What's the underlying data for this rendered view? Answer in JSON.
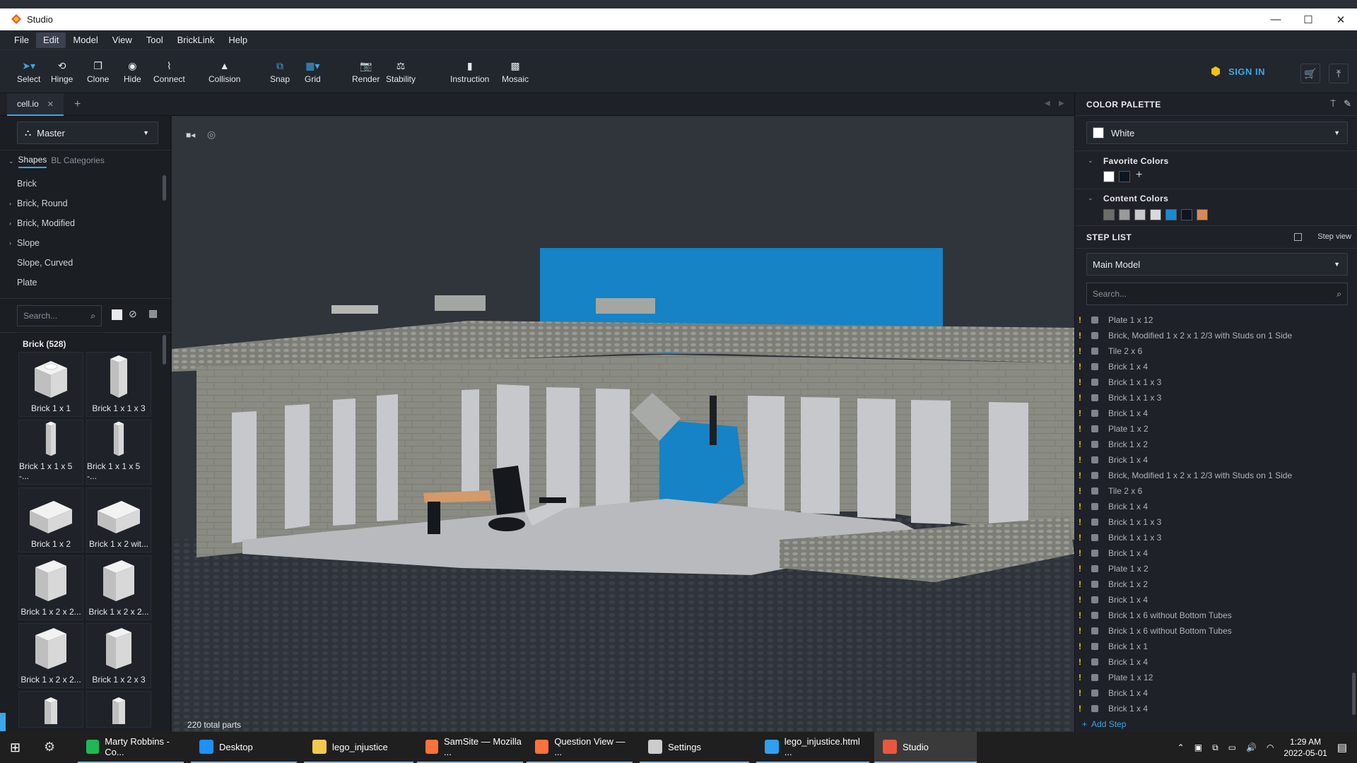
{
  "window": {
    "title": "Studio",
    "controls": [
      "—",
      "☐",
      "✕"
    ]
  },
  "menu": [
    "File",
    "Edit",
    "Model",
    "View",
    "Tool",
    "BrickLink",
    "Help"
  ],
  "toolbar": {
    "tools": [
      {
        "label": "Select",
        "icon": "cursor-icon"
      },
      {
        "label": "Hinge",
        "icon": "hinge-icon"
      },
      {
        "label": "Clone",
        "icon": "clone-icon"
      },
      {
        "label": "Hide",
        "icon": "hide-icon"
      },
      {
        "label": "Connect",
        "icon": "connect-icon"
      },
      {
        "label": "Collision",
        "icon": "collision-icon"
      },
      {
        "label": "Snap",
        "icon": "snap-icon"
      },
      {
        "label": "Grid",
        "icon": "grid-icon"
      },
      {
        "label": "Render",
        "icon": "camera-icon"
      },
      {
        "label": "Stability",
        "icon": "stability-icon"
      },
      {
        "label": "Instruction",
        "icon": "instruction-icon"
      },
      {
        "label": "Mosaic",
        "icon": "mosaic-icon"
      }
    ],
    "sign_in": "SIGN IN"
  },
  "tabs": {
    "active": "cell.io",
    "close": "✕",
    "add": "+"
  },
  "left": {
    "model_select": "Master",
    "shapes_tab": "Shapes",
    "bl_tab": "BL Categories",
    "categories": [
      {
        "label": "Brick",
        "expand": ""
      },
      {
        "label": "Brick, Round",
        "expand": "›"
      },
      {
        "label": "Brick, Modified",
        "expand": "›"
      },
      {
        "label": "Slope",
        "expand": "›"
      },
      {
        "label": "Slope, Curved",
        "expand": ""
      },
      {
        "label": "Plate",
        "expand": ""
      }
    ],
    "search_placeholder": "Search...",
    "group_title": "Brick (528)",
    "parts": [
      "Brick 1 x 1",
      "Brick 1 x 1 x 3",
      "Brick 1 x 1 x 5 -...",
      "Brick 1 x 1 x 5 -...",
      "Brick 1 x 2",
      "Brick 1 x 2 wit...",
      "Brick 1 x 2 x 2...",
      "Brick 1 x 2 x 2...",
      "Brick 1 x 2 x 2...",
      "Brick 1 x 2 x 3"
    ]
  },
  "viewport": {
    "parts_count": "220 total parts",
    "brick_color": "#8a8b82",
    "blue": "#1484c4"
  },
  "right": {
    "palette_title": "COLOR PALETTE",
    "color_select": "White",
    "favorite_title": "Favorite Colors",
    "favorite_colors": [
      "#ffffff",
      "#0b1620"
    ],
    "content_title": "Content Colors",
    "content_colors": [
      "#6b6e68",
      "#9a9c9b",
      "#c8c9cb",
      "#d9dadc",
      "#1a8ad4",
      "#0b1620",
      "#d8895a"
    ],
    "steplist_title": "STEP LIST",
    "step_view": "Step view",
    "model_select": "Main Model",
    "search_placeholder": "Search...",
    "steps": [
      "Plate 1 x 12",
      "Brick, Modified 1 x 2 x 1 2/3 with Studs on 1 Side",
      "Tile 2 x 6",
      "Brick 1 x 4",
      "Brick 1 x 1 x 3",
      "Brick 1 x 1 x 3",
      "Brick 1 x 4",
      "Plate 1 x 2",
      "Brick 1 x 2",
      "Brick 1 x 4",
      "Brick, Modified 1 x 2 x 1 2/3 with Studs on 1 Side",
      "Tile 2 x 6",
      "Brick 1 x 4",
      "Brick 1 x 1 x 3",
      "Brick 1 x 1 x 3",
      "Brick 1 x 4",
      "Plate 1 x 2",
      "Brick 1 x 2",
      "Brick 1 x 4",
      "Brick 1 x 6 without Bottom Tubes",
      "Brick 1 x 6 without Bottom Tubes",
      "Brick 1 x 1",
      "Brick 1 x 4",
      "Plate 1 x 12",
      "Brick 1 x 4",
      "Brick 1 x 4"
    ],
    "add_step": "Add Step"
  },
  "taskbar": {
    "items": [
      {
        "label": "Marty Robbins - Co...",
        "icon": "spotify-icon",
        "color": "#1db954"
      },
      {
        "label": "Desktop",
        "icon": "desktop-icon",
        "color": "#1e90ff"
      },
      {
        "label": "lego_injustice",
        "icon": "folder-icon",
        "color": "#f2c94c"
      },
      {
        "label": "SamSite — Mozilla ...",
        "icon": "firefox-icon",
        "color": "#ff7139"
      },
      {
        "label": "Question View — ...",
        "icon": "firefox-icon",
        "color": "#ff7139"
      },
      {
        "label": "Settings",
        "icon": "gear-icon",
        "color": "#cccccc"
      },
      {
        "label": "lego_injustice.html ...",
        "icon": "vscode-icon",
        "color": "#2f9ff0"
      },
      {
        "label": "Studio",
        "icon": "studio-icon",
        "color": "#e9573f"
      }
    ],
    "time": "1:29 AM",
    "date": "2022-05-01"
  }
}
